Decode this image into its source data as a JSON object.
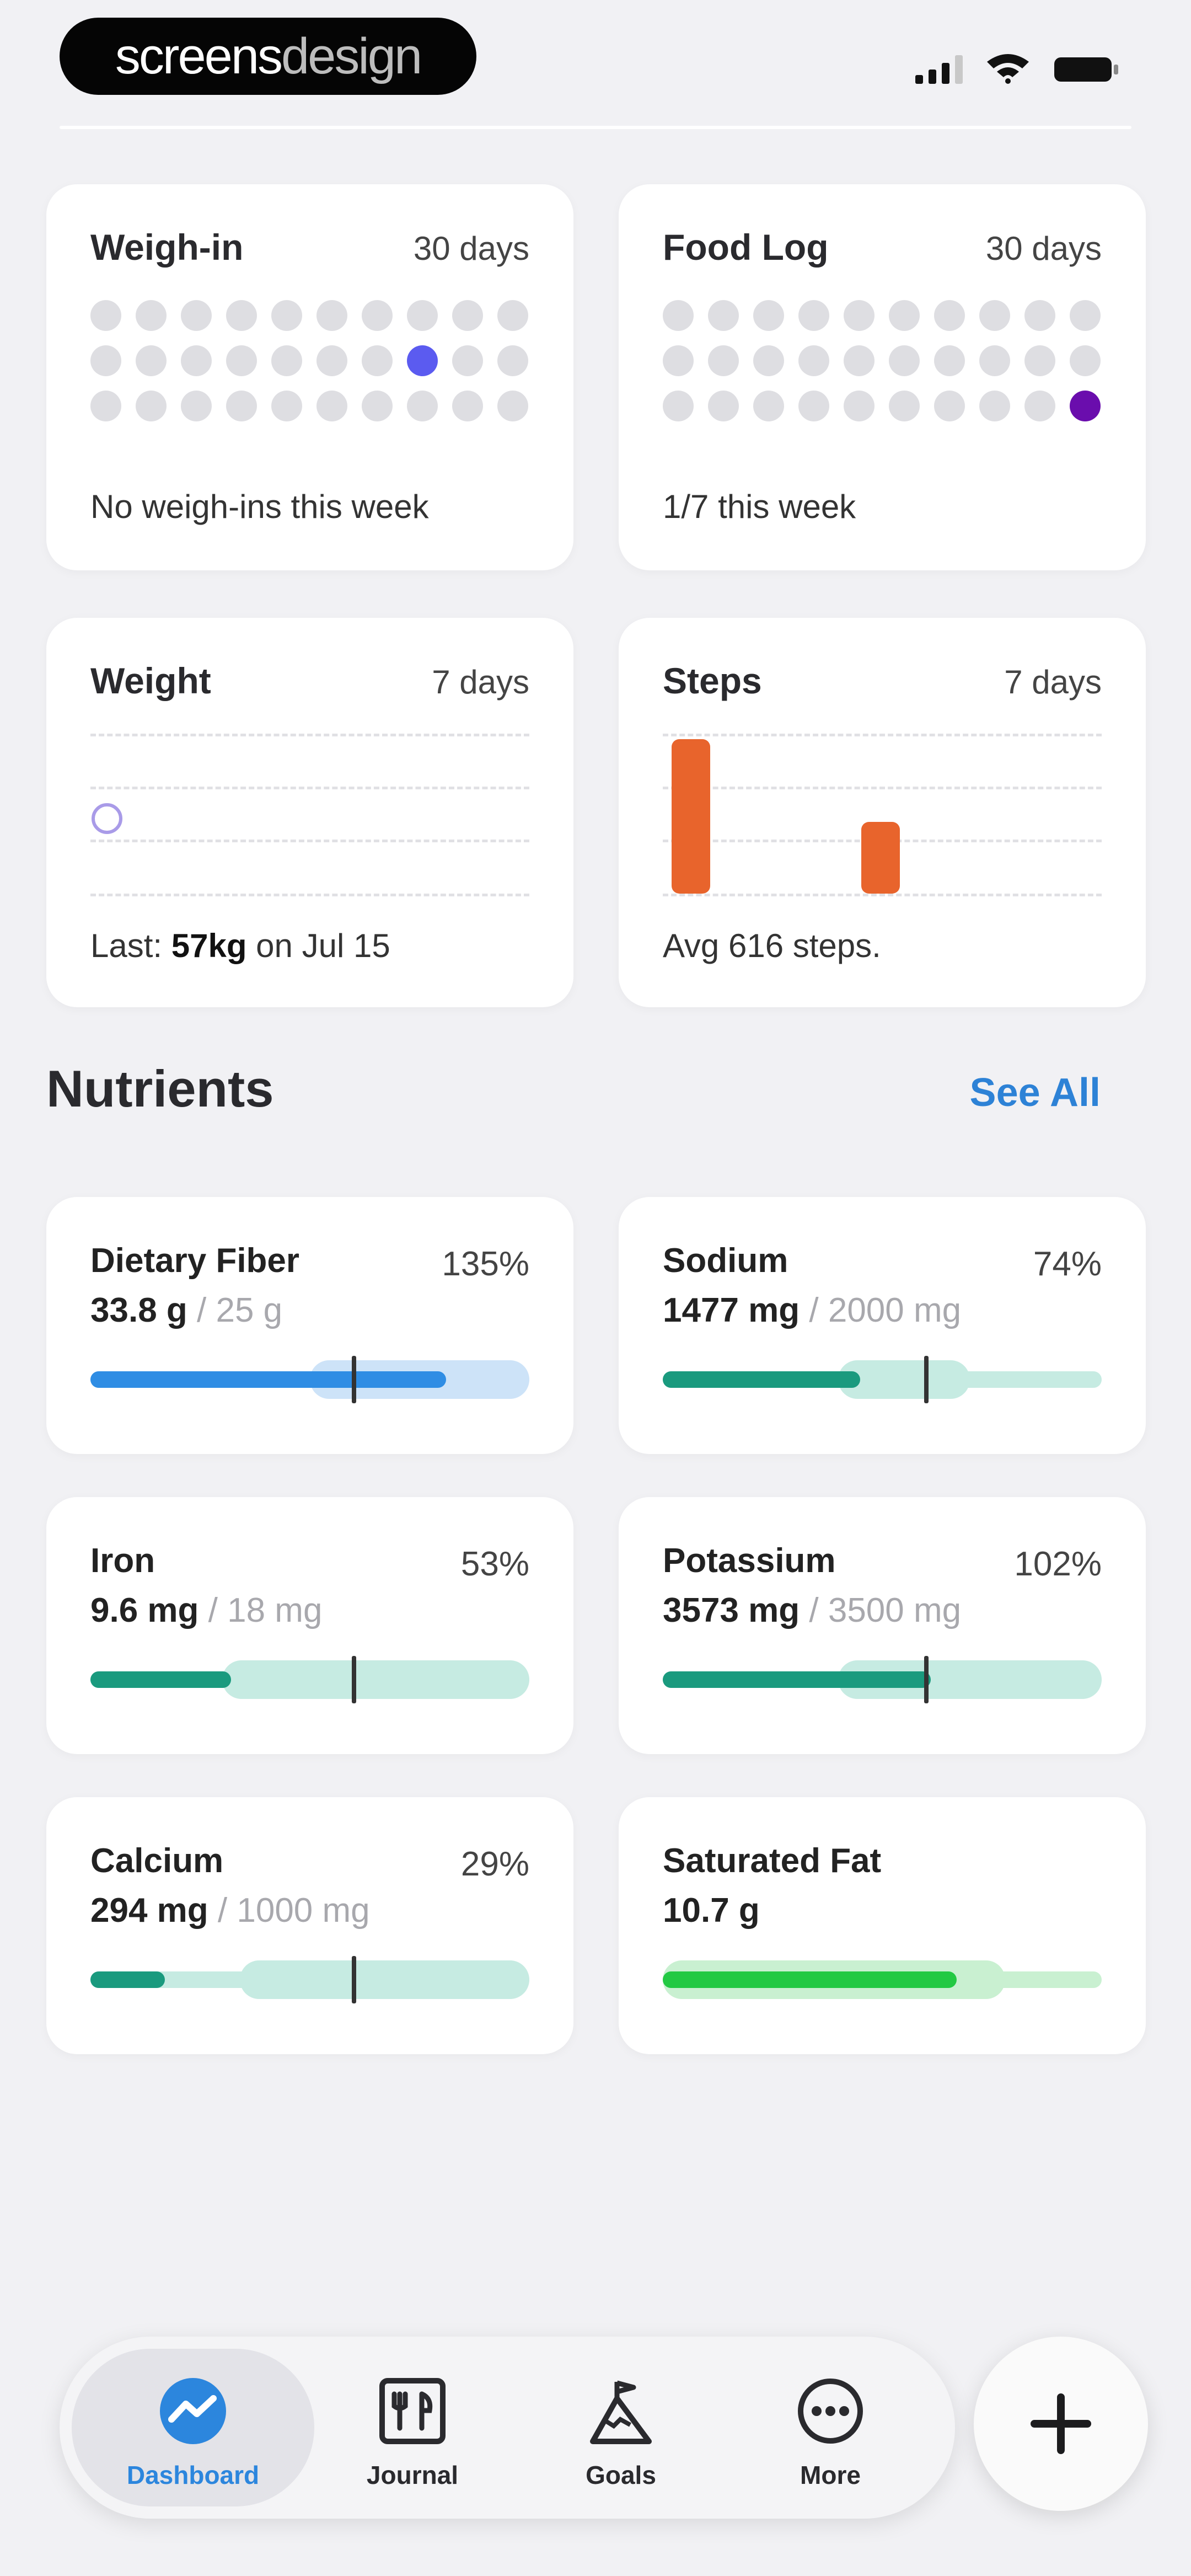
{
  "status_bar": {
    "brand_part1": "screens",
    "brand_part2": "design"
  },
  "cards": {
    "weigh_in": {
      "title": "Weigh-in",
      "period": "30 days",
      "footer": "No weigh-ins this week",
      "dot_color": "#5b5bf0"
    },
    "food_log": {
      "title": "Food Log",
      "period": "30 days",
      "footer": "1/7 this week",
      "dot_color": "#6a0dad"
    },
    "weight": {
      "title": "Weight",
      "period": "7 days",
      "footer_prefix": "Last: ",
      "footer_value": "57kg",
      "footer_suffix": " on Jul 15"
    },
    "steps": {
      "title": "Steps",
      "period": "7 days",
      "footer": "Avg 616 steps.",
      "bar_color": "#e8642c"
    }
  },
  "nutrients": {
    "title": "Nutrients",
    "see_all": "See All",
    "items": [
      {
        "name": "Dietary Fiber",
        "percent": "135%",
        "amount": "33.8 g",
        "goal": "25 g",
        "fill": 0.81,
        "band_start": 0.5,
        "band_end": 1.0,
        "marker": 0.6,
        "fill_color": "#2f8de4",
        "band_color": "#cde3f8"
      },
      {
        "name": "Sodium",
        "percent": "74%",
        "amount": "1477 mg",
        "goal": "2000 mg",
        "fill": 0.45,
        "band_start": 0.4,
        "band_end": 0.7,
        "marker": 0.6,
        "fill_color": "#1a9a7e",
        "band_color": "#c6ebe2"
      },
      {
        "name": "Iron",
        "percent": "53%",
        "amount": "9.6 mg",
        "goal": "18 mg",
        "fill": 0.32,
        "band_start": 0.3,
        "band_end": 1.0,
        "marker": 0.6,
        "fill_color": "#1a9a7e",
        "band_color": "#c6ebe2"
      },
      {
        "name": "Potassium",
        "percent": "102%",
        "amount": "3573 mg",
        "goal": "3500 mg",
        "fill": 0.61,
        "band_start": 0.4,
        "band_end": 1.0,
        "marker": 0.6,
        "fill_color": "#1a9a7e",
        "band_color": "#c6ebe2"
      },
      {
        "name": "Calcium",
        "percent": "29%",
        "amount": "294 mg",
        "goal": "1000 mg",
        "fill": 0.17,
        "band_start": 0.34,
        "band_end": 1.0,
        "marker": 0.6,
        "fill_color": "#1a9a7e",
        "band_color": "#c6ebe2"
      },
      {
        "name": "Saturated Fat",
        "percent": "",
        "amount": "10.7 g",
        "goal": "",
        "fill": 0.67,
        "band_start": 0.0,
        "band_end": 0.78,
        "marker": null,
        "fill_color": "#22c943",
        "band_color": "#c9f0d1"
      }
    ]
  },
  "tabbar": {
    "tabs": [
      {
        "label": "Dashboard",
        "icon": "dashboard-icon",
        "active": true
      },
      {
        "label": "Journal",
        "icon": "journal-icon",
        "active": false
      },
      {
        "label": "Goals",
        "icon": "goals-icon",
        "active": false
      },
      {
        "label": "More",
        "icon": "more-icon",
        "active": false
      }
    ],
    "fab_icon": "plus-icon"
  },
  "colors": {
    "accent": "#2c86dd",
    "background": "#f1f1f4"
  }
}
